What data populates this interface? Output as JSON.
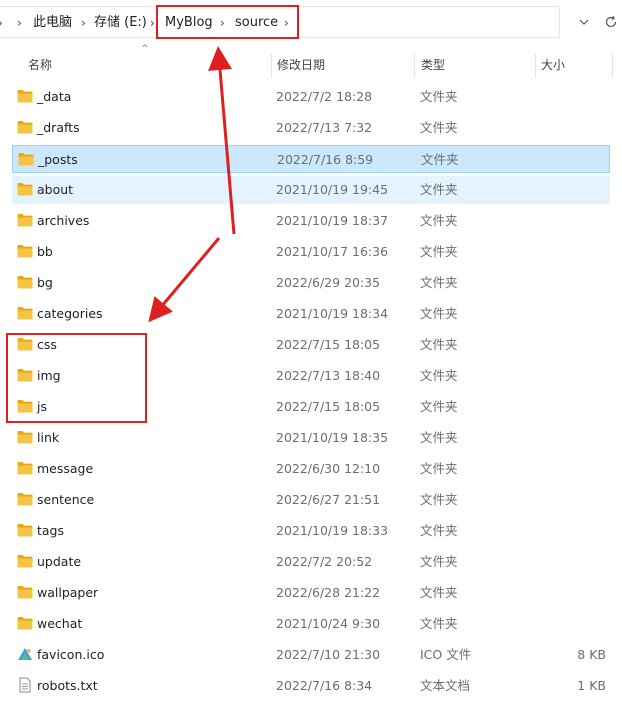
{
  "breadcrumb": {
    "pc": "此电脑",
    "drive": "存储 (E:)",
    "blog": "MyBlog",
    "source": "source"
  },
  "header": {
    "name": "名称",
    "date": "修改日期",
    "type": "类型",
    "size": "大小"
  },
  "files": [
    {
      "name": "_data",
      "date": "2022/7/2 18:28",
      "type": "文件夹",
      "size": "",
      "icon": "folder-icon"
    },
    {
      "name": "_drafts",
      "date": "2022/7/13 7:32",
      "type": "文件夹",
      "size": "",
      "icon": "folder-icon"
    },
    {
      "name": "_posts",
      "date": "2022/7/16 8:59",
      "type": "文件夹",
      "size": "",
      "icon": "folder-icon"
    },
    {
      "name": "about",
      "date": "2021/10/19 19:45",
      "type": "文件夹",
      "size": "",
      "icon": "folder-icon"
    },
    {
      "name": "archives",
      "date": "2021/10/19 18:37",
      "type": "文件夹",
      "size": "",
      "icon": "folder-icon"
    },
    {
      "name": "bb",
      "date": "2021/10/17 16:36",
      "type": "文件夹",
      "size": "",
      "icon": "folder-icon"
    },
    {
      "name": "bg",
      "date": "2022/6/29 20:35",
      "type": "文件夹",
      "size": "",
      "icon": "folder-icon"
    },
    {
      "name": "categories",
      "date": "2021/10/19 18:34",
      "type": "文件夹",
      "size": "",
      "icon": "folder-icon"
    },
    {
      "name": "css",
      "date": "2022/7/15 18:05",
      "type": "文件夹",
      "size": "",
      "icon": "folder-icon"
    },
    {
      "name": "img",
      "date": "2022/7/13 18:40",
      "type": "文件夹",
      "size": "",
      "icon": "folder-icon"
    },
    {
      "name": "js",
      "date": "2022/7/15 18:05",
      "type": "文件夹",
      "size": "",
      "icon": "folder-icon"
    },
    {
      "name": "link",
      "date": "2021/10/19 18:35",
      "type": "文件夹",
      "size": "",
      "icon": "folder-icon"
    },
    {
      "name": "message",
      "date": "2022/6/30 12:10",
      "type": "文件夹",
      "size": "",
      "icon": "folder-icon"
    },
    {
      "name": "sentence",
      "date": "2022/6/27 21:51",
      "type": "文件夹",
      "size": "",
      "icon": "folder-icon"
    },
    {
      "name": "tags",
      "date": "2021/10/19 18:33",
      "type": "文件夹",
      "size": "",
      "icon": "folder-icon"
    },
    {
      "name": "update",
      "date": "2022/7/2 20:52",
      "type": "文件夹",
      "size": "",
      "icon": "folder-icon"
    },
    {
      "name": "wallpaper",
      "date": "2022/6/28 21:22",
      "type": "文件夹",
      "size": "",
      "icon": "folder-icon"
    },
    {
      "name": "wechat",
      "date": "2021/10/24 9:30",
      "type": "文件夹",
      "size": "",
      "icon": "folder-icon"
    },
    {
      "name": "favicon.ico",
      "date": "2022/7/10 21:30",
      "type": "ICO 文件",
      "size": "8 KB",
      "icon": "ico-file-icon"
    },
    {
      "name": "robots.txt",
      "date": "2022/7/16 8:34",
      "type": "文本文档",
      "size": "1 KB",
      "icon": "text-file-icon"
    }
  ],
  "selected_index": 2,
  "hover_index": 3,
  "colors": {
    "folder": "#f6c445",
    "selection": "#cce8ff",
    "annotation": "#e02020"
  }
}
